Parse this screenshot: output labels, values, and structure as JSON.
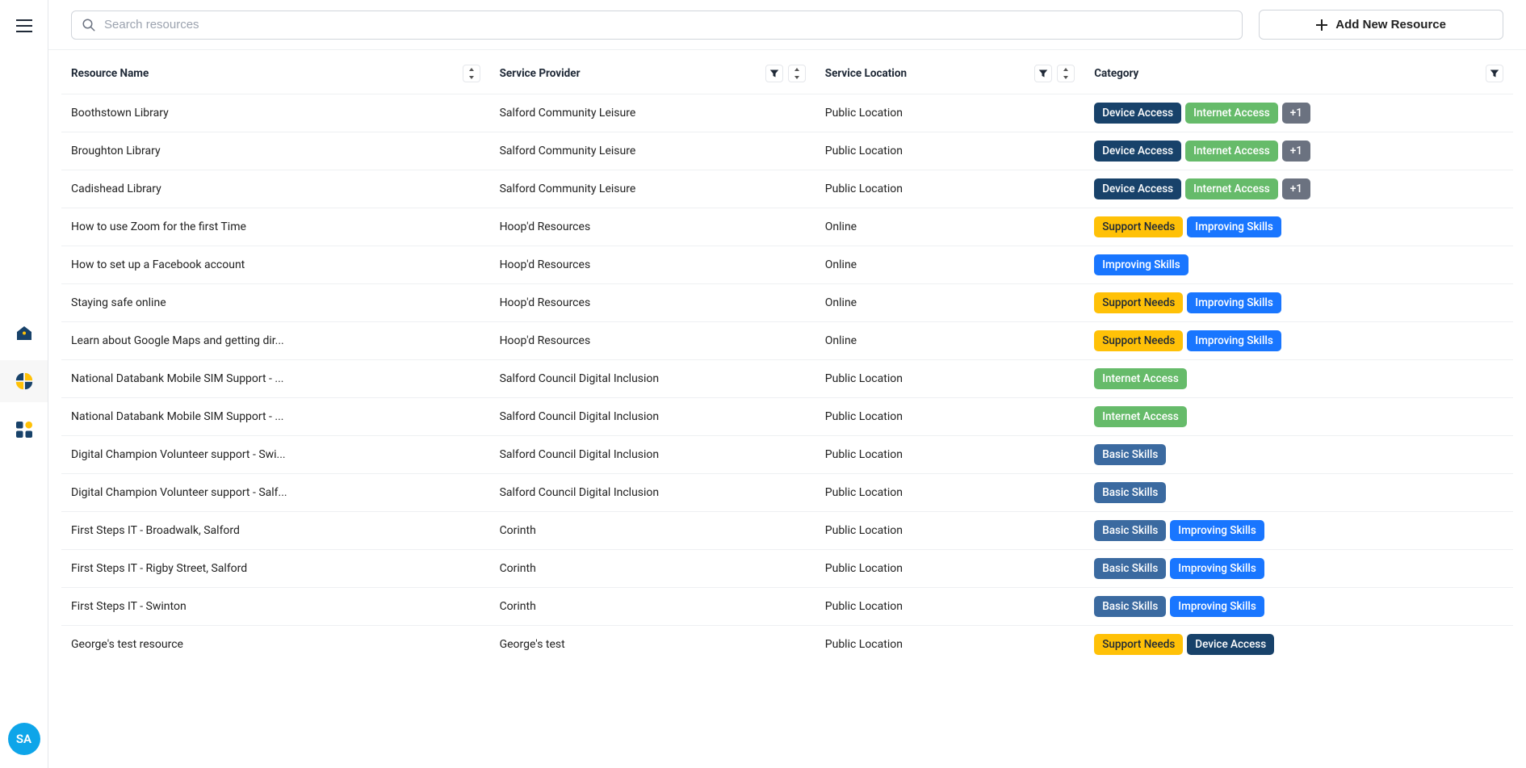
{
  "sidebar": {
    "avatar_initials": "SA"
  },
  "topbar": {
    "search_placeholder": "Search resources",
    "add_button_label": "Add New Resource"
  },
  "tag_colors": {
    "Device Access": "#18426a",
    "Internet Access": "#66bb6a",
    "Support Needs": "#ffc107",
    "Improving Skills": "#1976ff",
    "Basic Skills": "#3b6aa0"
  },
  "columns": [
    {
      "key": "name",
      "label": "Resource Name",
      "filter": false,
      "sort": true
    },
    {
      "key": "provider",
      "label": "Service Provider",
      "filter": true,
      "sort": true
    },
    {
      "key": "location",
      "label": "Service Location",
      "filter": true,
      "sort": true
    },
    {
      "key": "category",
      "label": "Category",
      "filter": true,
      "sort": false
    }
  ],
  "rows": [
    {
      "name": "Boothstown Library",
      "provider": "Salford Community Leisure",
      "location": "Public Location",
      "tags": [
        "Device Access",
        "Internet Access"
      ],
      "overflow": "+1"
    },
    {
      "name": "Broughton Library",
      "provider": "Salford Community Leisure",
      "location": "Public Location",
      "tags": [
        "Device Access",
        "Internet Access"
      ],
      "overflow": "+1"
    },
    {
      "name": "Cadishead Library",
      "provider": "Salford Community Leisure",
      "location": "Public Location",
      "tags": [
        "Device Access",
        "Internet Access"
      ],
      "overflow": "+1"
    },
    {
      "name": "How to use Zoom for the first Time",
      "provider": "Hoop'd Resources",
      "location": "Online",
      "tags": [
        "Support Needs",
        "Improving Skills"
      ]
    },
    {
      "name": "How to set up a Facebook account",
      "provider": "Hoop'd Resources",
      "location": "Online",
      "tags": [
        "Improving Skills"
      ]
    },
    {
      "name": "Staying safe online",
      "provider": "Hoop'd Resources",
      "location": "Online",
      "tags": [
        "Support Needs",
        "Improving Skills"
      ]
    },
    {
      "name": "Learn about Google Maps and getting dir...",
      "provider": "Hoop'd Resources",
      "location": "Online",
      "tags": [
        "Support Needs",
        "Improving Skills"
      ]
    },
    {
      "name": "National Databank Mobile SIM Support - ...",
      "provider": "Salford Council Digital Inclusion",
      "location": "Public Location",
      "tags": [
        "Internet Access"
      ]
    },
    {
      "name": "National Databank Mobile SIM Support - ...",
      "provider": "Salford Council Digital Inclusion",
      "location": "Public Location",
      "tags": [
        "Internet Access"
      ]
    },
    {
      "name": "Digital Champion Volunteer support - Swi...",
      "provider": "Salford Council Digital Inclusion",
      "location": "Public Location",
      "tags": [
        "Basic Skills"
      ]
    },
    {
      "name": "Digital Champion Volunteer support - Salf...",
      "provider": "Salford Council Digital Inclusion",
      "location": "Public Location",
      "tags": [
        "Basic Skills"
      ]
    },
    {
      "name": "First Steps IT - Broadwalk, Salford",
      "provider": "Corinth",
      "location": "Public Location",
      "tags": [
        "Basic Skills",
        "Improving Skills"
      ]
    },
    {
      "name": "First Steps IT - Rigby Street, Salford",
      "provider": "Corinth",
      "location": "Public Location",
      "tags": [
        "Basic Skills",
        "Improving Skills"
      ]
    },
    {
      "name": "First Steps IT - Swinton",
      "provider": "Corinth",
      "location": "Public Location",
      "tags": [
        "Basic Skills",
        "Improving Skills"
      ]
    },
    {
      "name": "George's test resource",
      "provider": "George's test",
      "location": "Public Location",
      "tags": [
        "Support Needs",
        "Device Access"
      ]
    }
  ]
}
